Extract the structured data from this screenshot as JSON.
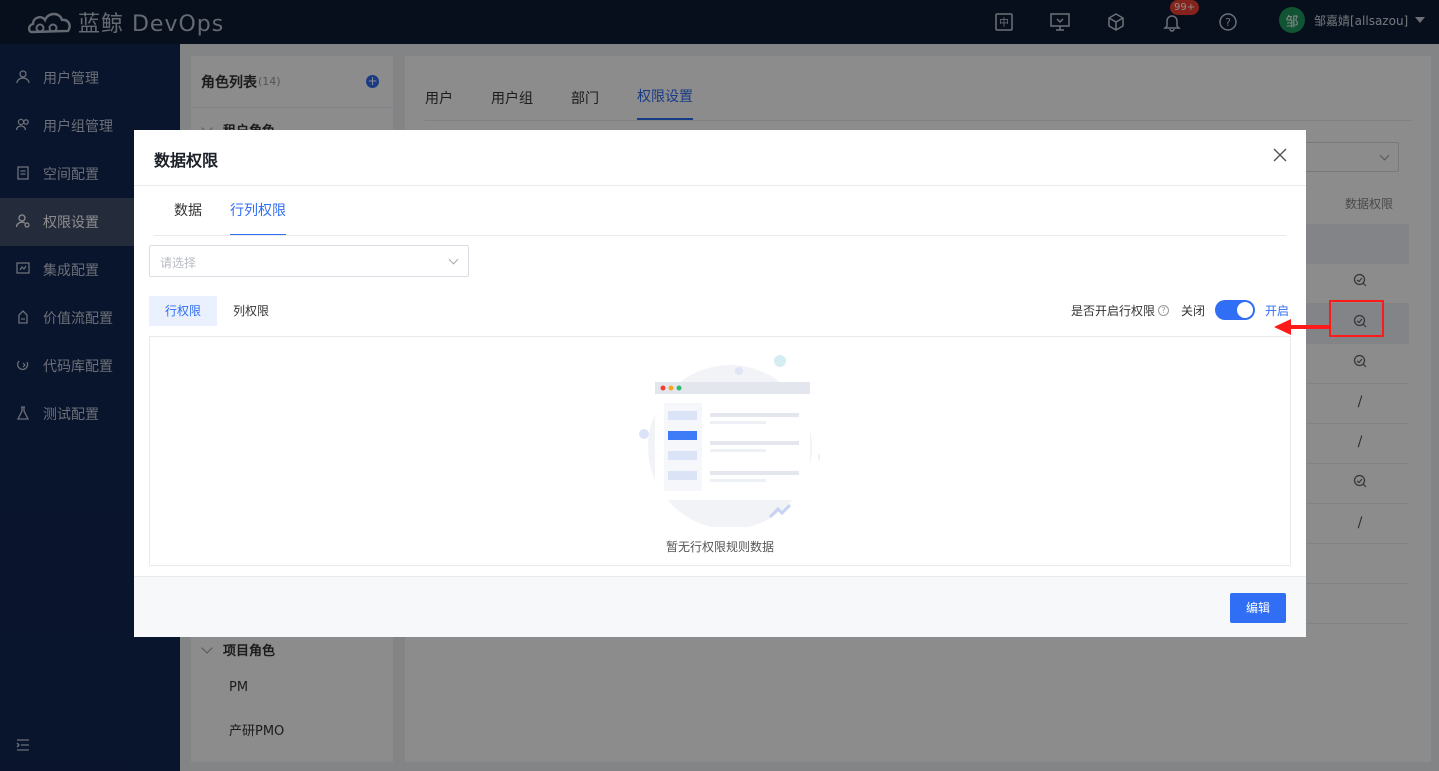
{
  "app": {
    "brand": "蓝鲸 DevOps",
    "user_avatar": "邹",
    "user_name": "邹嘉婧[allsazou]",
    "notification_badge": "99+"
  },
  "sidebar": {
    "items": [
      {
        "label": "用户管理",
        "icon": "user-icon"
      },
      {
        "label": "用户组管理",
        "icon": "users-icon"
      },
      {
        "label": "空间配置",
        "icon": "document-icon"
      },
      {
        "label": "权限设置",
        "icon": "permission-icon",
        "active": true
      },
      {
        "label": "集成配置",
        "icon": "integration-icon"
      },
      {
        "label": "价值流配置",
        "icon": "valuestream-icon"
      },
      {
        "label": "代码库配置",
        "icon": "code-icon"
      },
      {
        "label": "测试配置",
        "icon": "flask-icon"
      }
    ]
  },
  "roles": {
    "title": "角色列表",
    "count": "(14)",
    "group_tenant": "租户角色",
    "group_project": "项目角色",
    "items": [
      "PM",
      "产研PMO"
    ]
  },
  "main": {
    "tabs": [
      "用户",
      "用户组",
      "部门",
      "权限设置"
    ],
    "active_tab": "权限设置",
    "column_header": "数据权限",
    "row_values": [
      "/",
      "/",
      "/"
    ]
  },
  "modal": {
    "title": "数据权限",
    "tabs": [
      "数据",
      "行列权限"
    ],
    "active_tab": "行列权限",
    "select_placeholder": "请选择",
    "segments": [
      "行权限",
      "列权限"
    ],
    "active_segment": "行权限",
    "switch_label": "是否开启行权限",
    "switch_off": "关闭",
    "switch_on": "开启",
    "switch_state": "on",
    "empty_text": "暂无行权限规则数据",
    "edit_button": "编辑"
  },
  "colors": {
    "accent": "#2f6ef5",
    "sidebar": "#122552",
    "topbar": "#0e1b33",
    "annotation": "#ff1a1a"
  }
}
